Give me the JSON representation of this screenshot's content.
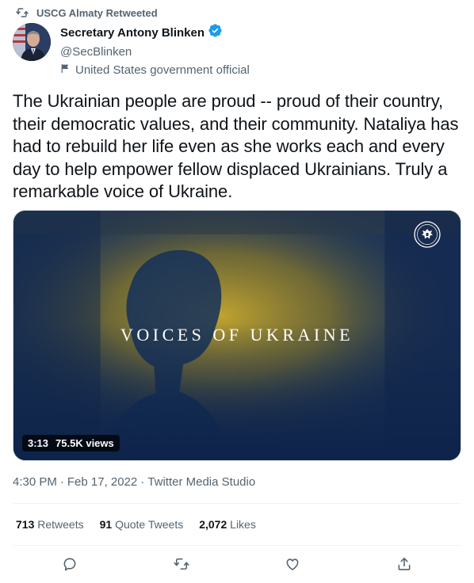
{
  "retweet_banner": {
    "text": "USCG Almaty Retweeted",
    "icon": "retweet-icon"
  },
  "author": {
    "name": "Secretary Antony Blinken",
    "handle": "@SecBlinken",
    "verified_icon": "verified-badge-icon",
    "label": "United States government official",
    "label_icon": "government-flag-icon"
  },
  "tweet": {
    "text": "The Ukrainian people are proud -- proud of their country, their democratic values, and their community. Nataliya has had to rebuild her life even as she works each and every day to help empower fellow displaced Ukrainians. Truly a remarkable voice of Ukraine."
  },
  "media": {
    "title": "VOICES OF UKRAINE",
    "duration": "3:13",
    "views": "75.5K views",
    "seal_icon": "state-department-seal-icon"
  },
  "meta": {
    "time": "4:30 PM",
    "date": "Feb 17, 2022",
    "separator": "·",
    "source": "Twitter Media Studio"
  },
  "stats": {
    "retweets_count": "713",
    "retweets_label": "Retweets",
    "quote_count": "91",
    "quote_label": "Quote Tweets",
    "likes_count": "2,072",
    "likes_label": "Likes"
  },
  "actions": [
    "reply-icon",
    "retweet-icon",
    "like-icon",
    "share-icon"
  ],
  "colors": {
    "secondary_text": "#536471",
    "verified_blue": "#1d9bf0",
    "ukraine_yellow": "#c9a92c",
    "ukraine_blue": "#1b3357"
  }
}
